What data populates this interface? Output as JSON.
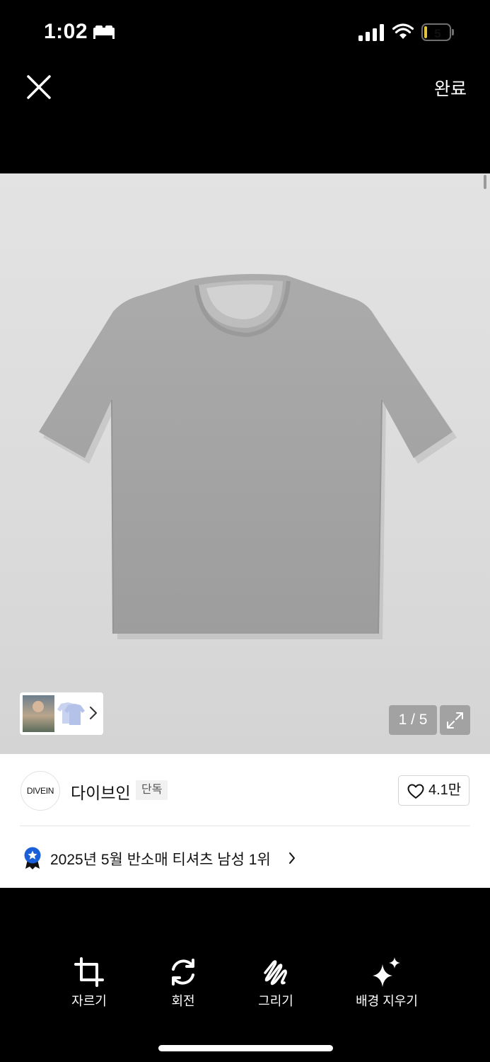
{
  "status_bar": {
    "time": "1:02",
    "battery_level": "5",
    "battery_fraction": 0.12,
    "battery_color": "#e4c43a",
    "icons": [
      "sleep-focus-icon",
      "cellular-signal-icon",
      "wifi-icon",
      "battery-icon"
    ]
  },
  "editor": {
    "close_icon": "close-icon",
    "done_label": "완료"
  },
  "product": {
    "image_alt": "grey short-sleeve t-shirt",
    "page_counter": "1 / 5",
    "expand_icon": "expand-icon",
    "brand_logo_text": "DIVEIN",
    "brand_name": "다이브인",
    "exclusive_badge": "단독",
    "like_count": "4.1만",
    "ranking_text": "2025년 5월 반소매 티셔츠 남성 1위",
    "ranking_badge_color": "#1a5fd8"
  },
  "toolbar": {
    "items": [
      {
        "label": "자르기",
        "icon": "crop-icon"
      },
      {
        "label": "회전",
        "icon": "rotate-icon"
      },
      {
        "label": "그리기",
        "icon": "draw-icon"
      },
      {
        "label": "배경 지우기",
        "icon": "sparkles-icon"
      }
    ]
  }
}
